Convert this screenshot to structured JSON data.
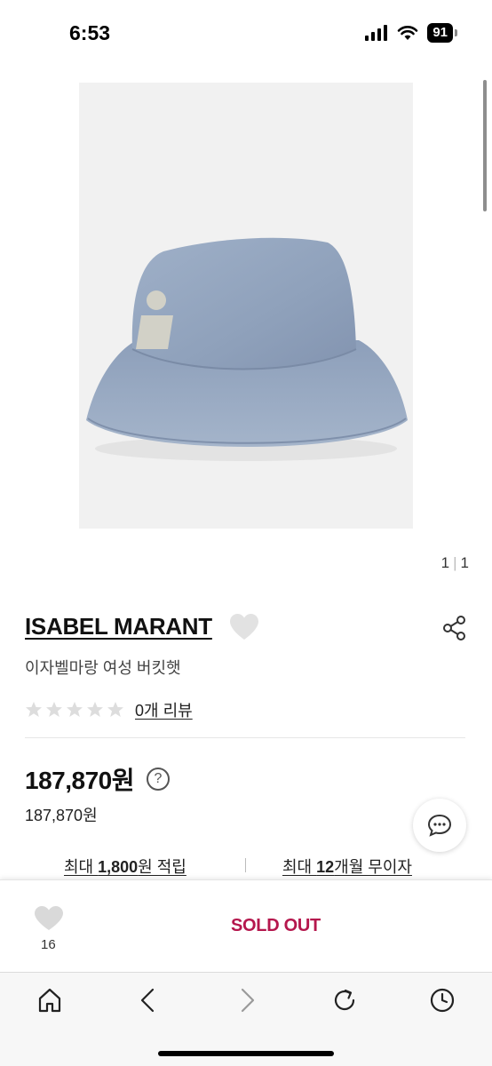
{
  "status_bar": {
    "time": "6:53",
    "battery": "91"
  },
  "gallery": {
    "current": "1",
    "total": "1"
  },
  "product": {
    "brand": "ISABEL MARANT",
    "title": "이자벨마랑 여성 버킷햇",
    "rating": 0,
    "review_link": "0개 리뷰",
    "price": "187,870원",
    "price_sub": "187,870원",
    "help_symbol": "?"
  },
  "benefits": {
    "points_prefix": "최대 ",
    "points_amount": "1,800",
    "points_suffix": "원 적립",
    "installment_prefix": "최대 ",
    "installment_months": "12",
    "installment_suffix": "개월 무이자"
  },
  "bottom_bar": {
    "like_count": "16",
    "sold_out_label": "SOLD OUT"
  },
  "colors": {
    "sold_out": "#b5174d",
    "heart_inactive": "#d9d9d9",
    "star_inactive": "#dddddd"
  },
  "icons": [
    "signal-icon",
    "wifi-icon",
    "battery-icon",
    "heart-icon",
    "share-icon",
    "star-icon",
    "help-icon",
    "chat-icon",
    "home-icon",
    "back-icon",
    "forward-icon",
    "reload-icon",
    "history-icon"
  ]
}
